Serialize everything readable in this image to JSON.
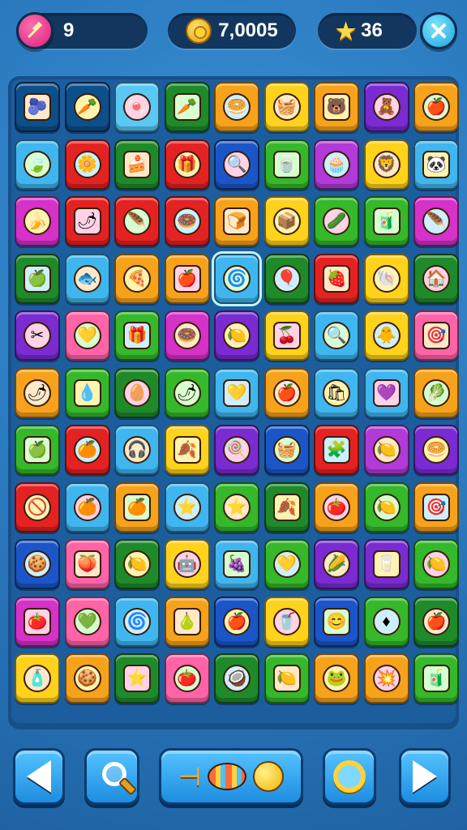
{
  "hud": {
    "moves_value": "9",
    "coins_value": "7,0005",
    "stars_value": "36"
  },
  "icons": {
    "moves": "rocket-icon",
    "coins": "coin-icon",
    "stars": "star-icon",
    "tools": "tools-icon"
  },
  "board": {
    "rows": 11,
    "cols": 9,
    "row_colors": [
      [
        "#0d4f8a",
        "#0d4f8a",
        "#59c8f5",
        "#1f8a2a",
        "#f7a21b",
        "#ffd21c",
        "#f7a21b",
        "#7a2bd1",
        "#f7a21b"
      ],
      [
        "#3fb6f0",
        "#e52222",
        "#1f8a2a",
        "#e52222",
        "#1b56c9",
        "#35b82a",
        "#b13ad8",
        "#ffd21c",
        "#3fb6f0"
      ],
      [
        "#d631c8",
        "#e52222",
        "#e52222",
        "#e52222",
        "#f7a21b",
        "#ffd21c",
        "#35b82a",
        "#35b82a",
        "#d631c8"
      ],
      [
        "#1f8a2a",
        "#3fb6f0",
        "#f7a21b",
        "#f7a21b",
        "#3fb6f0",
        "#1f8a2a",
        "#e52222",
        "#ffd21c",
        "#1f8a2a"
      ],
      [
        "#7a2bd1",
        "#ff63a8",
        "#35b82a",
        "#d631c8",
        "#7a2bd1",
        "#ffd21c",
        "#3fb6f0",
        "#ffd21c",
        "#ff63a8"
      ],
      [
        "#f7a21b",
        "#35b82a",
        "#1f8a2a",
        "#35b82a",
        "#3fb6f0",
        "#f7a21b",
        "#3fb6f0",
        "#3fb6f0",
        "#f7a21b"
      ],
      [
        "#35b82a",
        "#e52222",
        "#3fb6f0",
        "#ffd21c",
        "#7a2bd1",
        "#1b56c9",
        "#e52222",
        "#b13ad8",
        "#7a2bd1"
      ],
      [
        "#e52222",
        "#3fb6f0",
        "#f7a21b",
        "#3fb6f0",
        "#35b82a",
        "#1f8a2a",
        "#f7a21b",
        "#35b82a",
        "#f7a21b"
      ],
      [
        "#1b56c9",
        "#ff63a8",
        "#1f8a2a",
        "#ffd21c",
        "#3fb6f0",
        "#35b82a",
        "#7a2bd1",
        "#7a2bd1",
        "#35b82a"
      ],
      [
        "#d631c8",
        "#ff63a8",
        "#3fb6f0",
        "#f7a21b",
        "#1b56c9",
        "#ffd21c",
        "#1b56c9",
        "#35b82a",
        "#1f8a2a"
      ],
      [
        "#ffd21c",
        "#f7a21b",
        "#1f8a2a",
        "#ff63a8",
        "#1f8a2a",
        "#35b82a",
        "#f7a21b",
        "#f7a21b",
        "#35b82a"
      ]
    ],
    "row_glyphs": [
      [
        "🫐",
        "🥕",
        "🍬",
        "🥕",
        "🥯",
        "🧺",
        "🐻",
        "🧸",
        "🍎"
      ],
      [
        "🍃",
        "🌼",
        "🍰",
        "🎁",
        "🔍",
        "🍵",
        "🧁",
        "🦁",
        "🐼"
      ],
      [
        "🍌",
        "🌶",
        "🪶",
        "🍩",
        "🍞",
        "📦",
        "🥒",
        "🧃",
        "🪶"
      ],
      [
        "🍏",
        "🐟",
        "🍕",
        "🍎",
        "🌀",
        "🎈",
        "🍓",
        "🐚",
        "🏠"
      ],
      [
        "✂",
        "💛",
        "🎁",
        "🍩",
        "🍋",
        "🍒",
        "🔍",
        "🐥",
        "🎯"
      ],
      [
        "🌶",
        "💧",
        "🥚",
        "🌶",
        "💛",
        "🍎",
        "🛍",
        "💜",
        "🥬"
      ],
      [
        "🍏",
        "🍊",
        "🎧",
        "🍂",
        "🍭",
        "🧺",
        "🧩",
        "🍋",
        "🥯"
      ],
      [
        "🚫",
        "🍊",
        "🍊",
        "⭐",
        "⭐",
        "🍂",
        "🍅",
        "🍋",
        "🎯"
      ],
      [
        "🍪",
        "🍑",
        "🍋",
        "🤖",
        "🍇",
        "💛",
        "🌽",
        "🥛",
        "🍋"
      ],
      [
        "🍅",
        "💚",
        "🌀",
        "🍐",
        "🍎",
        "🥤",
        "😊",
        "♦",
        "🍎"
      ],
      [
        "🧴",
        "🍪",
        "⭐",
        "🍅",
        "🥥",
        "🍋",
        "🐸",
        "💥",
        "🧃"
      ]
    ]
  },
  "controls": {
    "back": "arrow-left-icon",
    "search": "magnifier-icon",
    "boosters": [
      "hammer-icon",
      "fish-icon",
      "fruit-icon"
    ],
    "hint": "hint-lens-icon",
    "next": "arrow-right-icon"
  }
}
